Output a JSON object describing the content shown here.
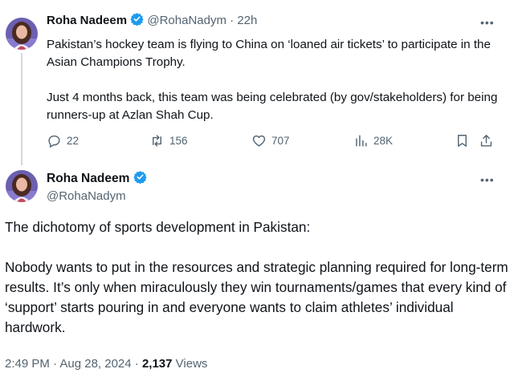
{
  "tweet1": {
    "author_name": "Roha Nadeem",
    "handle": "@RohaNadym",
    "separator": "·",
    "time": "22h",
    "paragraphs": [
      "Pakistan’s hockey team is flying to China on ‘loaned air tickets’ to participate in the Asian Champions Trophy.",
      "Just 4 months back, this team was being celebrated (by gov/stakeholders) for being runners-up at Azlan Shah Cup."
    ],
    "replies": "22",
    "reposts": "156",
    "likes": "707",
    "views": "28K"
  },
  "tweet2": {
    "author_name": "Roha Nadeem",
    "handle": "@RohaNadym",
    "paragraphs": [
      "The dichotomy of sports development in Pakistan:",
      "Nobody wants to put in the resources and strategic planning required for long-term results. It’s only when miraculously they win tournaments/games that every kind of ‘support’ starts pouring in and everyone wants to claim athletes’ individual hardwork."
    ],
    "timestamp": "2:49 PM · Aug 28, 2024 · ",
    "views_count": "2,137",
    "views_label": " Views"
  },
  "colors": {
    "verified_blue": "#1d9bf0",
    "secondary_text": "#536471",
    "primary_text": "#0f1419"
  },
  "icons": [
    "verified-badge-icon",
    "more-icon",
    "reply-icon",
    "repost-icon",
    "like-icon",
    "views-icon",
    "bookmark-icon",
    "share-icon"
  ]
}
